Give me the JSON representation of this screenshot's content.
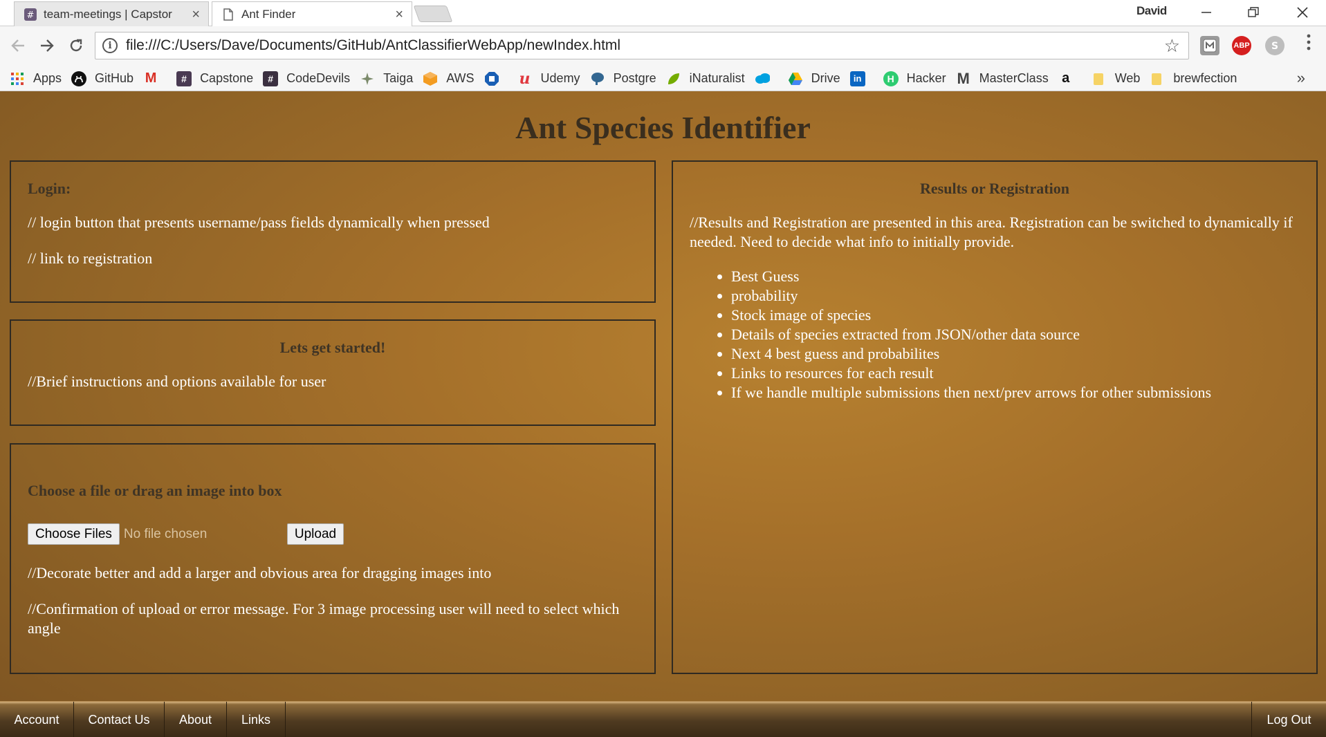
{
  "browser": {
    "tabs": [
      {
        "title": "team-meetings | Capstor",
        "icon": "slack-hash-icon"
      },
      {
        "title": "Ant Finder",
        "icon": "document-icon"
      }
    ],
    "user": "David",
    "url": "file:///C:/Users/Dave/Documents/GitHub/AntClassifierWebApp/newIndex.html",
    "extensions": [
      "mendeley",
      "adblock-plus",
      "skype"
    ],
    "ext_labels": {
      "abp": "ABP"
    },
    "bookmarks": [
      {
        "label": "Apps",
        "icon": "apps-grid-icon"
      },
      {
        "label": "GitHub",
        "icon": "github-icon"
      },
      {
        "label": "",
        "icon": "gmail-icon"
      },
      {
        "label": "Capstone",
        "icon": "hash-icon"
      },
      {
        "label": "CodeDevils",
        "icon": "hash-icon"
      },
      {
        "label": "Taiga",
        "icon": "taiga-icon"
      },
      {
        "label": "AWS",
        "icon": "aws-icon"
      },
      {
        "label": "",
        "icon": "chase-icon"
      },
      {
        "label": "Udemy",
        "icon": "udemy-icon"
      },
      {
        "label": "Postgre",
        "icon": "postgres-icon"
      },
      {
        "label": "iNaturalist",
        "icon": "inaturalist-icon"
      },
      {
        "label": "",
        "icon": "salesforce-icon"
      },
      {
        "label": "Drive",
        "icon": "drive-icon"
      },
      {
        "label": "",
        "icon": "linkedin-icon"
      },
      {
        "label": "Hacker",
        "icon": "hacker-icon"
      },
      {
        "label": "MasterClass",
        "icon": "masterclass-icon"
      },
      {
        "label": "",
        "icon": "amazon-icon"
      },
      {
        "label": "Web",
        "icon": "folder-icon"
      },
      {
        "label": "brewfection",
        "icon": "folder-icon"
      }
    ],
    "bookmark_icon_text": {
      "gmail": "M",
      "hash": "#",
      "linkedin": "in",
      "hacker": "H",
      "masterclass": "M",
      "amazon": "a",
      "udemy": "u"
    },
    "more": "»"
  },
  "page": {
    "title": "Ant Species Identifier",
    "login": {
      "heading": "Login:",
      "lines": [
        "// login button that presents username/pass fields dynamically when pressed",
        "// link to registration"
      ]
    },
    "start": {
      "heading": "Lets get started!",
      "lines": [
        "//Brief instructions and options available for user"
      ]
    },
    "upload": {
      "heading": "Choose a file or drag an image into box",
      "choose_label": "Choose Files",
      "no_file": "No file chosen",
      "upload_label": "Upload",
      "lines": [
        "//Decorate better and add a larger and obvious area for dragging images into",
        "//Confirmation of upload or error message. For 3 image processing user will need to select which angle"
      ]
    },
    "results": {
      "heading": "Results or Registration",
      "intro": "//Results and Registration are presented in this area. Registration can be switched to dynamically if needed. Need to decide what info to initially provide.",
      "items": [
        "Best Guess",
        "probability",
        "Stock image of species",
        "Details of species extracted from JSON/other data source",
        "Next 4 best guess and probabilites",
        "Links to resources for each result",
        "If we handle multiple submissions then next/prev arrows for other submissions"
      ]
    },
    "footer": {
      "items": [
        "Account",
        "Contact Us",
        "About",
        "Links"
      ],
      "logout": "Log Out"
    }
  }
}
